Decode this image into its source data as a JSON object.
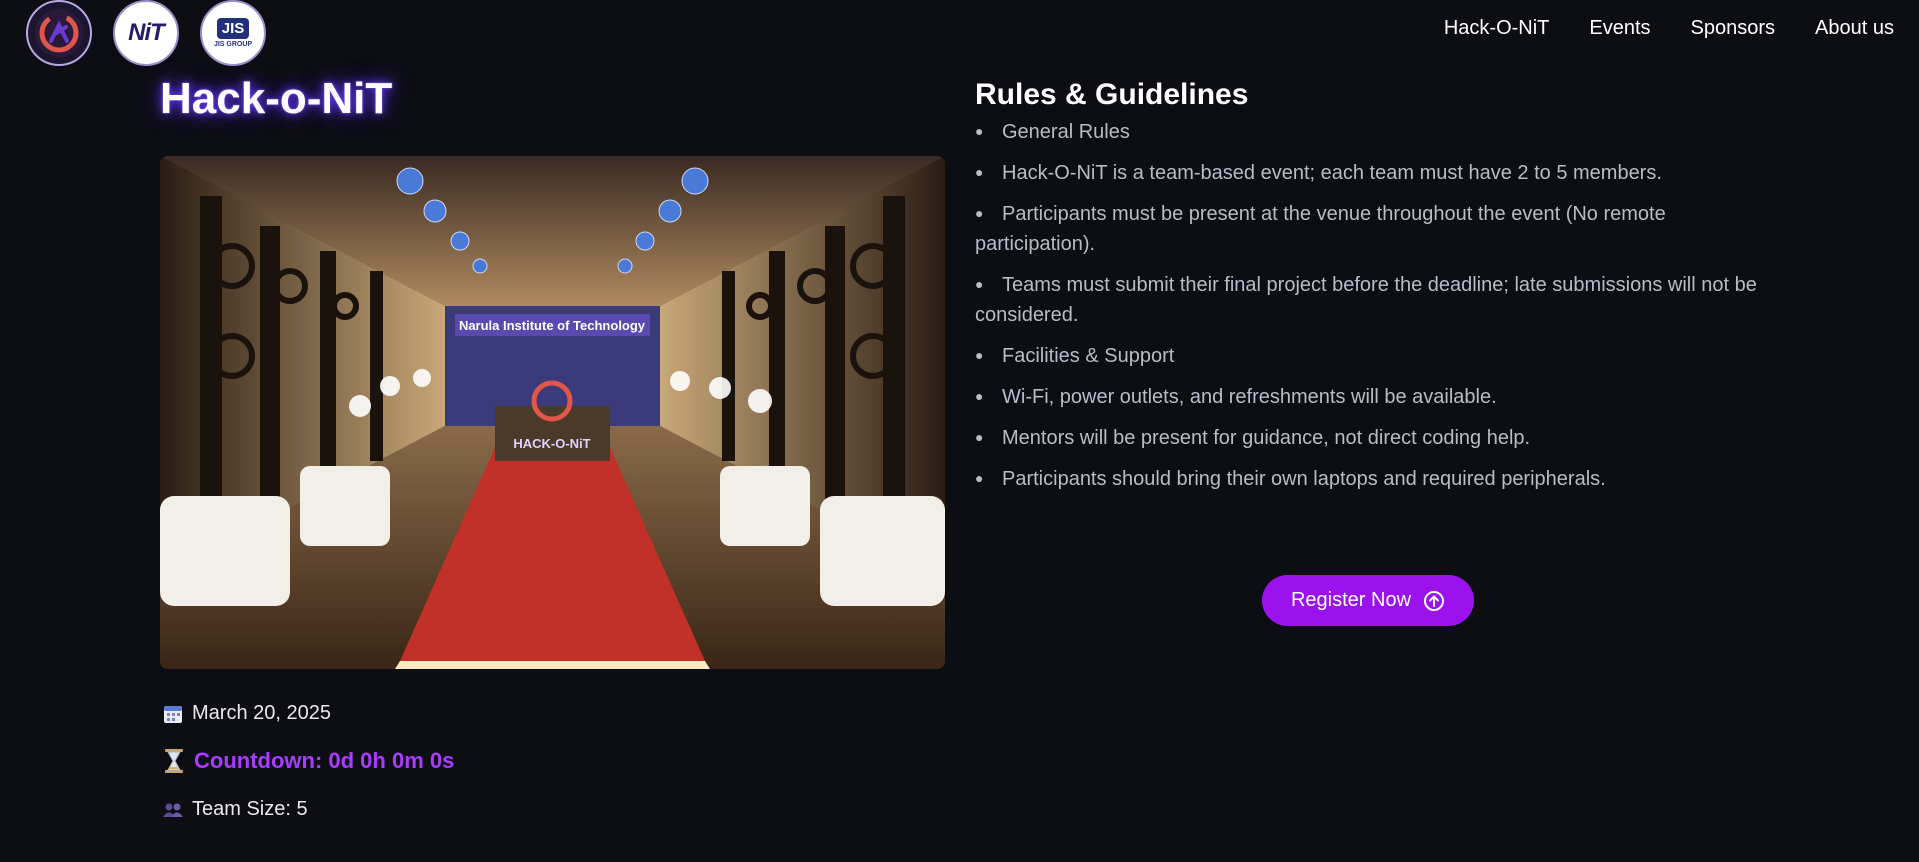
{
  "nav": {
    "logos": [
      "hack-o-nit-logo",
      "nit-logo",
      "jis-group-logo"
    ],
    "logo_texts": {
      "nit": "NiT",
      "jis": "JIS",
      "jis_sub": "JIS GROUP"
    },
    "links": [
      "Hack-O-NiT",
      "Events",
      "Sponsors",
      "About us"
    ]
  },
  "event": {
    "title": "Hack-o-NiT",
    "photo_banner": "Narula Institute of Technology",
    "photo_sign": "HACK-O-NiT",
    "date_icon": "calendar-icon",
    "date": "March 20, 2025",
    "countdown_icon": "hourglass-icon",
    "countdown": "Countdown: 0d 0h 0m 0s",
    "team_icon": "team-icon",
    "team_size": "Team Size: 5"
  },
  "rules": {
    "title": "Rules & Guidelines",
    "items": [
      "General Rules",
      "Hack-O-NiT is a team-based event; each team must have 2 to 5 members.",
      "Participants must be present at the venue throughout the event (No remote participation).",
      "Teams must submit their final project before the deadline; late submissions will not be considered.",
      "Facilities & Support",
      "Wi-Fi, power outlets, and refreshments will be available.",
      "Mentors will be present for guidance, not direct coding help.",
      "Participants should bring their own laptops and required peripherals."
    ]
  },
  "register": {
    "label": "Register Now",
    "icon": "arrow-up-circle-icon"
  },
  "colors": {
    "background": "#0d0e14",
    "accent": "#9b12ef",
    "countdown": "#a83cff",
    "rule_text": "#b8bcc8"
  }
}
